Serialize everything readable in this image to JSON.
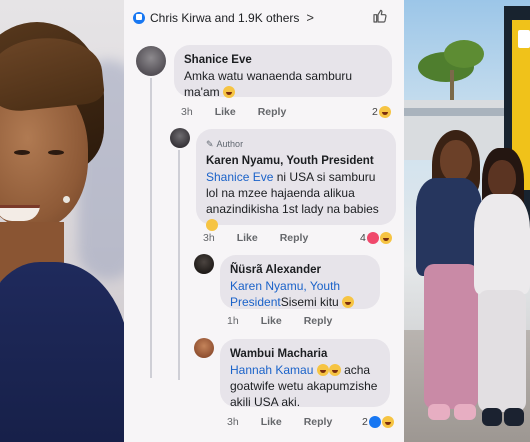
{
  "left_photo": {
    "alt": "woman-portrait"
  },
  "reactions_bar": {
    "text": "Chris Kirwa and 1.9K others",
    "chevron": ">",
    "icon": "blue-reaction-icon",
    "like_icon": "thumbs-up-outline-icon"
  },
  "comments": [
    {
      "name": "Shanice Eve",
      "text": "Amka watu wanaenda samburu ma'am",
      "emoji_suffix": "laugh",
      "time": "3h",
      "like_label": "Like",
      "reply_label": "Reply",
      "reaction_count": "2"
    },
    {
      "author_badge": "Author",
      "name": "Karen Nyamu, Youth President",
      "mention": "Shanice Eve",
      "text": " ni USA si samburu lol na mzee hajaenda alikua anazindikisha 1st lady na babies",
      "time": "3h",
      "like_label": "Like",
      "reply_label": "Reply",
      "reaction_count": "4"
    },
    {
      "name": "Ñüsrã Alexander",
      "mention": "Karen Nyamu, Youth President",
      "text": "Sisemi kitu",
      "time": "1h",
      "like_label": "Like",
      "reply_label": "Reply"
    },
    {
      "name": "Wambui Macharia",
      "mention": "Hannah Kamau",
      "text": " acha goatwife wetu akapumzishe akili USA aki.",
      "time": "3h",
      "like_label": "Like",
      "reply_label": "Reply",
      "reaction_count": "2"
    }
  ],
  "right_photo": {
    "alt": "woman-and-girl-photo"
  },
  "colors": {
    "mention": "#1a62c9",
    "bubble": "#e7e4ea",
    "panel": "#f7f5f7",
    "facebook_blue": "#1877f2"
  }
}
